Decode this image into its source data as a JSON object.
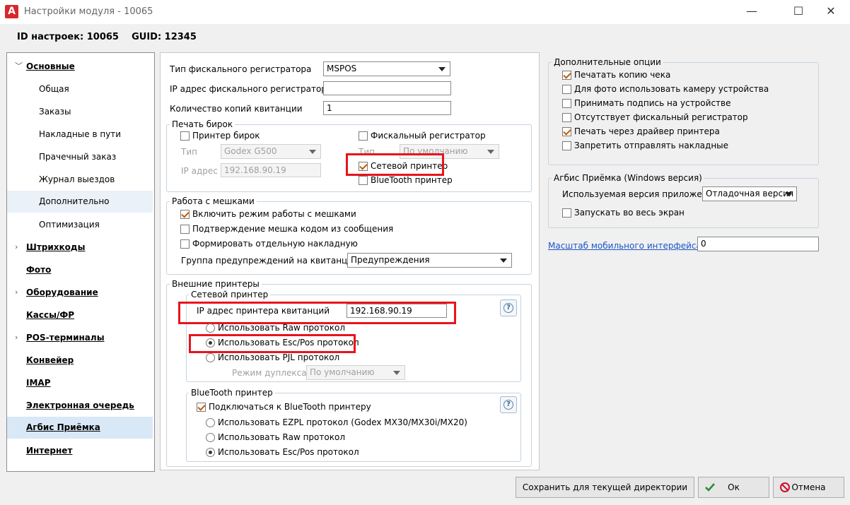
{
  "window": {
    "title": "Настройки модуля - 10065",
    "logo": "A",
    "minimize_glyph": "—",
    "maximize_glyph": "☐",
    "close_glyph": "✕"
  },
  "header": {
    "settings_id": "ID настроек: 10065",
    "guid": "GUID: 12345"
  },
  "nav": {
    "items": [
      {
        "label": "Основные",
        "kind": "top",
        "expanded": true
      },
      {
        "label": "Общая",
        "kind": "sub"
      },
      {
        "label": "Заказы",
        "kind": "sub"
      },
      {
        "label": "Накладные в пути",
        "kind": "sub"
      },
      {
        "label": "Прачечный заказ",
        "kind": "sub"
      },
      {
        "label": "Журнал выездов",
        "kind": "sub"
      },
      {
        "label": "Дополнительно",
        "kind": "sub"
      },
      {
        "label": "Оптимизация",
        "kind": "sub"
      },
      {
        "label": "Штрихкоды",
        "kind": "top",
        "expandable": true
      },
      {
        "label": "Фото",
        "kind": "top"
      },
      {
        "label": "Оборудование",
        "kind": "top",
        "expandable": true
      },
      {
        "label": "Кассы/ФР",
        "kind": "top"
      },
      {
        "label": "POS-терминалы",
        "kind": "top",
        "expandable": true
      },
      {
        "label": "Конвейер",
        "kind": "top"
      },
      {
        "label": "IMAP",
        "kind": "top"
      },
      {
        "label": "Электронная очередь",
        "kind": "top"
      },
      {
        "label": "Агбис Приёмка",
        "kind": "top",
        "selected": true
      },
      {
        "label": "Интернет",
        "kind": "top"
      }
    ]
  },
  "main": {
    "fiscal_type_label": "Тип фискального регистратора",
    "fiscal_type_value": "MSPOS",
    "fiscal_ip_label": "IP адрес фискального регистратора",
    "fiscal_ip_value": "",
    "copies_label": "Количество копий квитанции",
    "copies_value": "1",
    "tag_print": {
      "title": "Печать бирок",
      "tag_printer_label": "Принтер бирок",
      "tag_printer_checked": false,
      "type_label": "Тип",
      "type_value": "Godex G500",
      "ip_label": "IP адрес",
      "ip_value": "192.168.90.19",
      "fiscal_reg_label": "Фискальный регистратор",
      "fiscal_reg_checked": false,
      "type2_label": "Тип",
      "type2_value": "По умолчанию",
      "network_printer_label": "Сетевой принтер",
      "network_printer_checked": true,
      "bluetooth_label": "BlueTooth принтер",
      "bluetooth_checked": false
    },
    "bags": {
      "title": "Работа с мешками",
      "enable_label": "Включить режим работы с мешками",
      "enable_checked": true,
      "confirm_label": "Подтверждение мешка кодом из сообщения",
      "confirm_checked": false,
      "separate_label": "Формировать отдельную накладную",
      "separate_checked": false,
      "warn_group_label": "Группа предупреждений на квитанции",
      "warn_group_value": "Предупреждения"
    },
    "ext_printers": {
      "title": "Внешние принтеры",
      "network": {
        "title": "Сетевой принтер",
        "ip_label": "IP адрес принтера квитанций",
        "ip_value": "192.168.90.19",
        "raw_label": "Использовать Raw протокол",
        "escpos_label": "Использовать Esc/Pos протокол",
        "pjl_label": "Использовать PJL протокол",
        "selected": "escpos",
        "duplex_label": "Режим дуплекса",
        "duplex_value": "По умолчанию"
      },
      "bluetooth": {
        "title": "BlueTooth принтер",
        "connect_label": "Подключаться к BlueTooth принтеру",
        "connect_checked": true,
        "ezpl_label": "Использовать EZPL протокол (Godex MX30/MX30i/MX20)",
        "raw_label": "Использовать Raw протокол",
        "escpos_label": "Использовать Esc/Pos протокол",
        "selected": "escpos"
      },
      "help_glyph": "?"
    }
  },
  "right": {
    "extra": {
      "title": "Дополнительные опции",
      "options": [
        {
          "label": "Печатать копию чека",
          "checked": true
        },
        {
          "label": "Для фото использовать камеру устройства",
          "checked": false
        },
        {
          "label": "Принимать подпись на устройстве",
          "checked": false
        },
        {
          "label": "Отсутствует фискальный регистратор",
          "checked": false
        },
        {
          "label": "Печать через драйвер принтера",
          "checked": true
        },
        {
          "label": "Запретить отправлять накладные",
          "checked": false
        }
      ]
    },
    "agbis": {
      "title": "Агбис Приёмка (Windows версия)",
      "version_label": "Используемая версия приложения",
      "version_value": "Отладочная версия",
      "fullscreen_label": "Запускать во весь экран",
      "fullscreen_checked": false
    },
    "scale_link": "Масштаб мобильного интерфейса",
    "scale_value": "0"
  },
  "footer": {
    "save_label": "Сохранить для текущей директории",
    "ok_label": "Ок",
    "cancel_label": "Отмена"
  },
  "colors": {
    "highlight_red": "#e8141b",
    "selected_nav": "#d9e8f7",
    "link": "#1a55c7"
  }
}
